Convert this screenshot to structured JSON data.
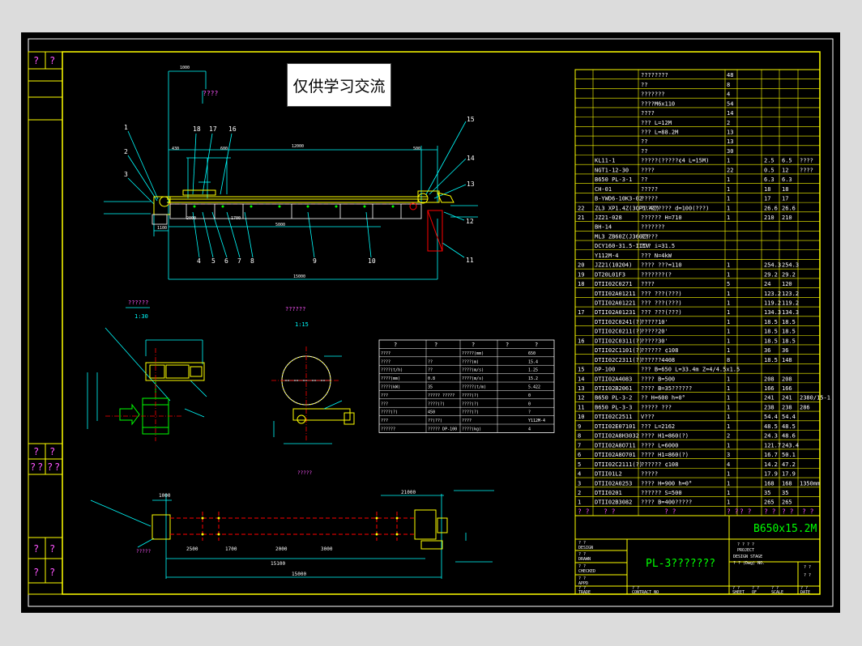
{
  "watermark": "仅供学习交流",
  "view_labels": {
    "top_note": "????",
    "view_a_title": "??????",
    "view_a_scale": "1:30",
    "view_b_title": "??????",
    "view_b_scale": "1:15",
    "plan_title": "?????",
    "plan_note": "?????"
  },
  "dims": {
    "d5000": "5000",
    "d15000": "15000",
    "d21000": "21000",
    "d12000": "12000",
    "d1100": "1100",
    "d1700": "1700",
    "d2000": "2000",
    "d3000": "3000",
    "d2500": "2500",
    "d1000": "1000",
    "d600": "600",
    "d430": "430",
    "d500": "500",
    "d15100": "15100"
  },
  "callouts": [
    "1",
    "2",
    "3",
    "4",
    "5",
    "6",
    "7",
    "8",
    "9",
    "10",
    "11",
    "12",
    "13",
    "14",
    "15",
    "16",
    "17",
    "18"
  ],
  "spec_table": {
    "headers": [
      "?",
      "?",
      "?",
      "?",
      "?"
    ],
    "rows": [
      [
        "????",
        "",
        "?????(mm)",
        "",
        "650"
      ],
      [
        "????",
        "??",
        "????(m)",
        "",
        "15.4"
      ],
      [
        "????(t/h)",
        "??",
        "????(m/s)",
        "",
        "1.25"
      ],
      [
        "????(mm)",
        "0.8",
        "????(m/s)",
        "",
        "15.2"
      ],
      [
        "????(kW)",
        "35",
        "?????(t/m)",
        "",
        "5.422"
      ],
      [
        "???",
        "????? ?????",
        "????(?)",
        "",
        "0"
      ],
      [
        "???",
        "????(?)",
        "????(?)",
        "",
        "0"
      ],
      [
        "????(?)",
        "450",
        "????(?)",
        "",
        "?"
      ],
      [
        "???",
        "??(??)",
        "????",
        "",
        "Y112M-4"
      ],
      [
        "??????",
        "????? DP-100",
        "????(kg)",
        "",
        "4"
      ]
    ]
  },
  "parts_list": {
    "rows": [
      {
        "no": "",
        "code": "",
        "name": "????????",
        "qty": "48",
        "w1": "",
        "w2": "",
        "note": ""
      },
      {
        "no": "",
        "code": "",
        "name": "??",
        "qty": "8",
        "w1": "",
        "w2": "",
        "note": ""
      },
      {
        "no": "",
        "code": "",
        "name": "???????",
        "qty": "4",
        "w1": "",
        "w2": "",
        "note": ""
      },
      {
        "no": "",
        "code": "",
        "name": "????M6x110",
        "qty": "54",
        "w1": "",
        "w2": "",
        "note": ""
      },
      {
        "no": "",
        "code": "",
        "name": "????",
        "qty": "14",
        "w1": "",
        "w2": "",
        "note": ""
      },
      {
        "no": "",
        "code": "",
        "name": "???      L=12M",
        "qty": "2",
        "w1": "",
        "w2": "",
        "note": ""
      },
      {
        "no": "",
        "code": "",
        "name": "???   L=88.2M",
        "qty": "13",
        "w1": "",
        "w2": "",
        "note": ""
      },
      {
        "no": "",
        "code": "",
        "name": "??",
        "qty": "13",
        "w1": "",
        "w2": "",
        "note": ""
      },
      {
        "no": "",
        "code": "",
        "name": "??",
        "qty": "30",
        "w1": "",
        "w2": "",
        "note": ""
      },
      {
        "no": "",
        "code": "KL11-1",
        "name": "?????(?????¢4   L=15M)",
        "qty": "1",
        "w1": "2.5",
        "w2": "6.5",
        "note": "????"
      },
      {
        "no": "",
        "code": "NGT1-12-30",
        "name": "????",
        "qty": "22",
        "w1": "0.5",
        "w2": "12",
        "note": "????"
      },
      {
        "no": "",
        "code": "B650 PL-3-1",
        "name": "??",
        "qty": "1",
        "w1": "6.3",
        "w2": "6.3",
        "note": ""
      },
      {
        "no": "",
        "code": "CH-01",
        "name": "?????",
        "qty": "1",
        "w1": "18",
        "w2": "18",
        "note": ""
      },
      {
        "no": "",
        "code": "B-YWD6-10K3-02",
        "name": "?????",
        "qty": "1",
        "w1": "17",
        "w2": "17",
        "note": ""
      },
      {
        "no": "22",
        "code": "ZL3 XP1.4Z(3QP1.4Z)",
        "name": "????????? d=100(???)",
        "qty": "1",
        "w1": "26.6",
        "w2": "26.6",
        "note": ""
      },
      {
        "no": "21",
        "code": "JZ21-028",
        "name": "??????  H=710",
        "qty": "1",
        "w1": "210",
        "w2": "210",
        "note": ""
      },
      {
        "no": "",
        "code": "BH-14",
        "name": "???????",
        "qty": "",
        "w1": "",
        "w2": "",
        "note": ""
      },
      {
        "no": "",
        "code": "ML3 ZB60Z(J360Z)",
        "name": "?????",
        "qty": "",
        "w1": "",
        "w2": "",
        "note": ""
      },
      {
        "no": "",
        "code": "DCY160-31.5-IIIV",
        "name": "???  i=31.5",
        "qty": "",
        "w1": "",
        "w2": "",
        "note": ""
      },
      {
        "no": "",
        "code": "Y112M-4",
        "name": "???  N=4kW",
        "qty": "",
        "w1": "",
        "w2": "",
        "note": ""
      },
      {
        "no": "20",
        "code": "JZ21(10204)",
        "name": "????  ???=110",
        "qty": "1",
        "w1": "254.3",
        "w2": "254.3",
        "note": ""
      },
      {
        "no": "19",
        "code": "DT20L01F3",
        "name": "???????(?",
        "qty": "1",
        "w1": "29.2",
        "w2": "29.2",
        "note": ""
      },
      {
        "no": "18",
        "code": "DTII02C0271",
        "name": "????",
        "qty": "5",
        "w1": "24",
        "w2": "120",
        "note": ""
      },
      {
        "no": "",
        "code": "DTII02A01211",
        "name": "???  ???(???)",
        "qty": "1",
        "w1": "123.2",
        "w2": "123.2",
        "note": ""
      },
      {
        "no": "",
        "code": "DTII02A01221",
        "name": "???  ???(???)",
        "qty": "1",
        "w1": "119.2",
        "w2": "119.2",
        "note": ""
      },
      {
        "no": "17",
        "code": "DTII02A01231",
        "name": "???  ???(???)",
        "qty": "1",
        "w1": "134.3",
        "w2": "134.3",
        "note": ""
      },
      {
        "no": "",
        "code": "DTII02C0241(?)",
        "name": "?????10'",
        "qty": "1",
        "w1": "18.5",
        "w2": "18.5",
        "note": ""
      },
      {
        "no": "",
        "code": "DTII02C0211(?)",
        "name": "?????20'",
        "qty": "1",
        "w1": "18.5",
        "w2": "18.5",
        "note": ""
      },
      {
        "no": "16",
        "code": "DTII02C0311(?)",
        "name": "?????30'",
        "qty": "1",
        "w1": "18.5",
        "w2": "18.5",
        "note": ""
      },
      {
        "no": "",
        "code": "DTII02C1101(?)",
        "name": "??????  ¢108",
        "qty": "1",
        "w1": "36",
        "w2": "36",
        "note": ""
      },
      {
        "no": "",
        "code": "DTII02C2311(?)",
        "name": "??????4408",
        "qty": "8",
        "w1": "18.5",
        "w2": "148",
        "note": ""
      },
      {
        "no": "15",
        "code": "DP-100",
        "name": "???  B=650 L=33.4m Z=4/4.5x1.5",
        "qty": "",
        "w1": "",
        "w2": "",
        "note": ""
      },
      {
        "no": "14",
        "code": "DTII02A4083",
        "name": "????  B=500",
        "qty": "1",
        "w1": "208",
        "w2": "208",
        "note": ""
      },
      {
        "no": "13",
        "code": "DTII02B2061",
        "name": "????  B=35??????",
        "qty": "1",
        "w1": "166",
        "w2": "166",
        "note": ""
      },
      {
        "no": "12",
        "code": "B650 PL-3-2",
        "name": "??  H=600 h=0°",
        "qty": "1",
        "w1": "241",
        "w2": "241",
        "note": "2380/15-1"
      },
      {
        "no": "11",
        "code": "B650 PL-3-3",
        "name": "?????  ???",
        "qty": "1",
        "w1": "238",
        "w2": "238",
        "note": "286"
      },
      {
        "no": "10",
        "code": "DTII02C2511",
        "name": "V???",
        "qty": "1",
        "w1": "54.4",
        "w2": "54.4",
        "note": ""
      },
      {
        "no": "9",
        "code": "DTII02E07101",
        "name": "???  L=2162",
        "qty": "1",
        "w1": "48.5",
        "w2": "48.5",
        "note": ""
      },
      {
        "no": "8",
        "code": "DTII02A8H3032",
        "name": "????  H1=860(?)",
        "qty": "2",
        "w1": "24.3",
        "w2": "48.6",
        "note": ""
      },
      {
        "no": "7",
        "code": "DTII02A8O711",
        "name": "????  L=6000",
        "qty": "1",
        "w1": "121.7",
        "w2": "243.4",
        "note": ""
      },
      {
        "no": "6",
        "code": "DTII02A8O701",
        "name": "????  H1=860(?)",
        "qty": "3",
        "w1": "16.7",
        "w2": "50.1",
        "note": ""
      },
      {
        "no": "5",
        "code": "DTII02C2111(?)",
        "name": "??????   ¢108",
        "qty": "4",
        "w1": "14.2",
        "w2": "47.2",
        "note": ""
      },
      {
        "no": "4",
        "code": "DTII01L2",
        "name": "?????",
        "qty": "1",
        "w1": "17.9",
        "w2": "17.9",
        "note": ""
      },
      {
        "no": "3",
        "code": "DTII02A0253",
        "name": "????  H=900 h=0°",
        "qty": "1",
        "w1": "168",
        "w2": "168",
        "note": "1350mm"
      },
      {
        "no": "2",
        "code": "DTII0201",
        "name": "??????  S=500",
        "qty": "1",
        "w1": "35",
        "w2": "35",
        "note": ""
      },
      {
        "no": "1",
        "code": "DTII02B3082",
        "name": "????  B=400?????",
        "qty": "1",
        "w1": "265",
        "w2": "265",
        "note": ""
      }
    ],
    "header": [
      "?  ?",
      "?  ?",
      "?  ?",
      "?  ?",
      "? ?",
      "? ?",
      "? ?",
      "?  ?"
    ]
  },
  "title_block": {
    "drawing_name": "B650x15.2M",
    "drawing_no": "PL-3???????",
    "company_lines": [
      "? ? ? ?",
      "PROJECT",
      "DESIGN STAGE",
      "? ? (Dwg) NO."
    ],
    "left_labels": [
      "? ?",
      "DESIGN",
      "? ?",
      "DRAWN",
      "? ?",
      "CHECKED",
      "? ?",
      "APPD"
    ],
    "bottom_labels": [
      "? ?",
      "TRADE",
      "? ?",
      "CONTRACT NO",
      "? ?",
      "SHEET",
      "? ?",
      "OF",
      "? ?",
      "SCALE",
      "? ?",
      "DATE"
    ],
    "sheet_no": "? ?",
    "revision": "? ?"
  },
  "left_strip": {
    "top": [
      "?",
      "?"
    ],
    "mid": [
      "?",
      "?",
      "?",
      "?",
      "?",
      "?"
    ],
    "bot": [
      "?",
      "?",
      "?",
      "?"
    ]
  }
}
